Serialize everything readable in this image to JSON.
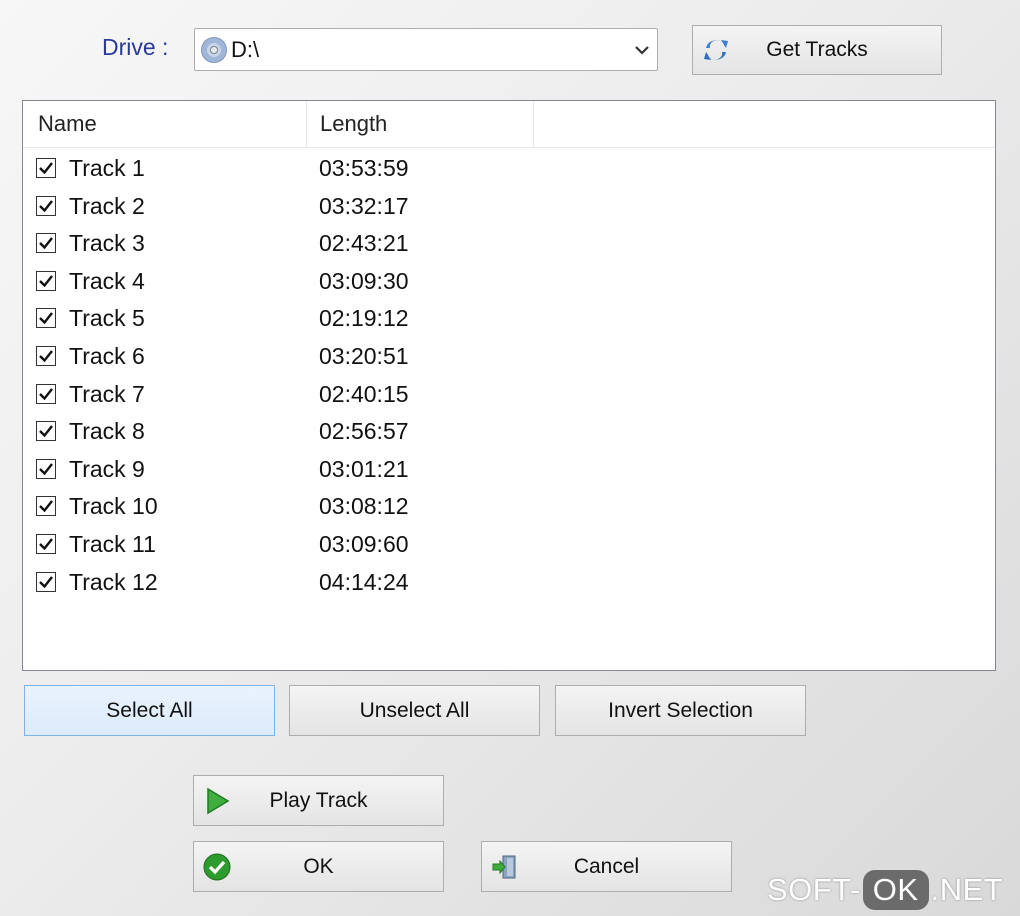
{
  "drive": {
    "label": "Drive :",
    "value": "D:\\",
    "icon": "disc-icon"
  },
  "get_tracks": {
    "label": "Get Tracks",
    "icon": "refresh-icon"
  },
  "list": {
    "columns": {
      "name": "Name",
      "length": "Length"
    },
    "rows": [
      {
        "name": "Track 1",
        "length": "03:53:59",
        "checked": true
      },
      {
        "name": "Track 2",
        "length": "03:32:17",
        "checked": true
      },
      {
        "name": "Track 3",
        "length": "02:43:21",
        "checked": true
      },
      {
        "name": "Track 4",
        "length": "03:09:30",
        "checked": true
      },
      {
        "name": "Track 5",
        "length": "02:19:12",
        "checked": true
      },
      {
        "name": "Track 6",
        "length": "03:20:51",
        "checked": true
      },
      {
        "name": "Track 7",
        "length": "02:40:15",
        "checked": true
      },
      {
        "name": "Track 8",
        "length": "02:56:57",
        "checked": true
      },
      {
        "name": "Track 9",
        "length": "03:01:21",
        "checked": true
      },
      {
        "name": "Track 10",
        "length": "03:08:12",
        "checked": true
      },
      {
        "name": "Track 11",
        "length": "03:09:60",
        "checked": true
      },
      {
        "name": "Track 12",
        "length": "04:14:24",
        "checked": true
      }
    ]
  },
  "selection": {
    "select_all": "Select All",
    "unselect_all": "Unselect All",
    "invert": "Invert Selection"
  },
  "actions": {
    "play": "Play Track",
    "ok": "OK",
    "cancel": "Cancel"
  },
  "watermark": {
    "left": "SOFT-",
    "middle": "OK",
    "right": ".NET"
  },
  "colors": {
    "drive_label": "#2a3a9a",
    "selected_button": "#dcebfb",
    "play_icon": "#3fae3f",
    "ok_icon": "#2e9b2e"
  }
}
